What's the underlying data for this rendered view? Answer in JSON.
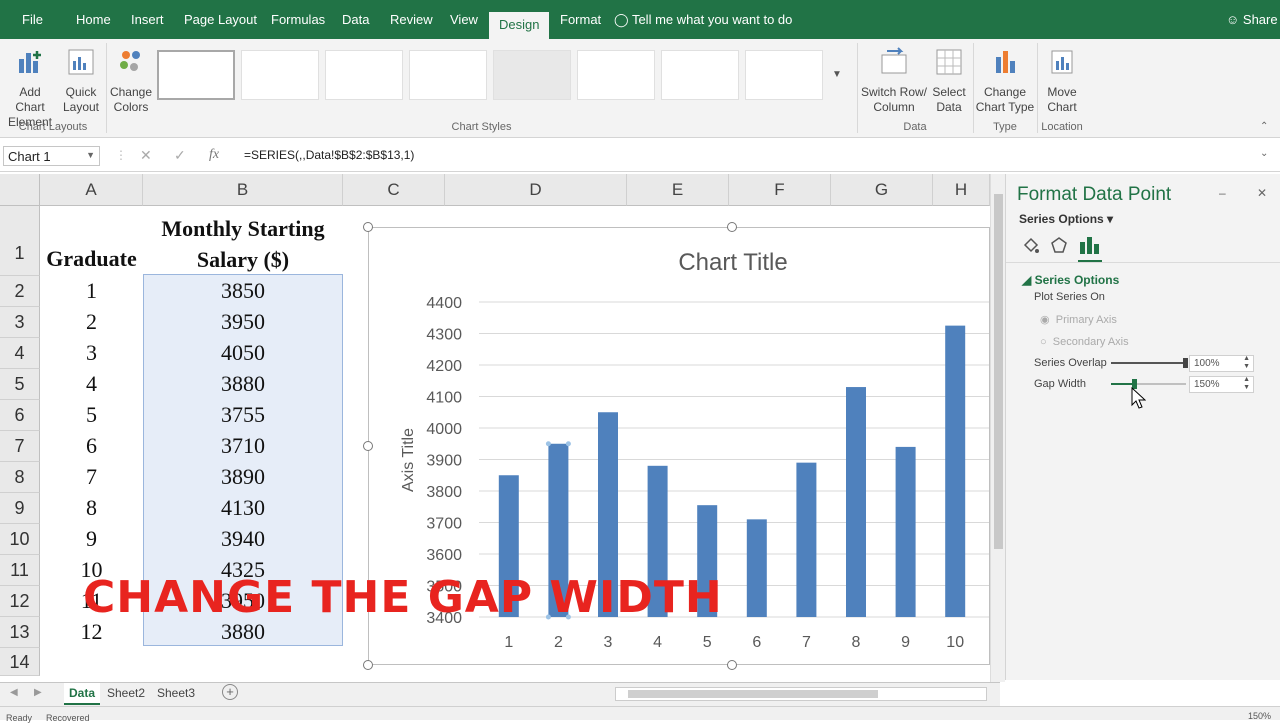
{
  "tabs": [
    "File",
    "Home",
    "Insert",
    "Page Layout",
    "Formulas",
    "Data",
    "Review",
    "View",
    "Design",
    "Format"
  ],
  "active_tab": "Design",
  "tell_me": "Tell me what you want to do",
  "share": "Share",
  "ribbon": {
    "add_chart_element": "Add Chart Element",
    "quick_layout": "Quick Layout",
    "change_colors": "Change Colors",
    "switch_row_column": "Switch Row/ Column",
    "select_data": "Select Data",
    "change_chart_type": "Change Chart Type",
    "move_chart": "Move Chart",
    "groups": [
      "Chart Layouts",
      "Chart Styles",
      "Data",
      "Type",
      "Location"
    ]
  },
  "formula_bar": {
    "name_box": "Chart 1",
    "fx": "fx",
    "formula": "=SERIES(,,Data!$B$2:$B$13,1)"
  },
  "columns": [
    "A",
    "B",
    "C",
    "D",
    "E",
    "F",
    "G",
    "H"
  ],
  "header_a": "Graduate",
  "header_b": "Monthly Starting Salary ($)",
  "rows": [
    {
      "r": "1"
    },
    {
      "r": "2",
      "a": "1",
      "b": "3850"
    },
    {
      "r": "3",
      "a": "2",
      "b": "3950"
    },
    {
      "r": "4",
      "a": "3",
      "b": "4050"
    },
    {
      "r": "5",
      "a": "4",
      "b": "3880"
    },
    {
      "r": "6",
      "a": "5",
      "b": "3755"
    },
    {
      "r": "7",
      "a": "6",
      "b": "3710"
    },
    {
      "r": "8",
      "a": "7",
      "b": "3890"
    },
    {
      "r": "9",
      "a": "8",
      "b": "4130"
    },
    {
      "r": "10",
      "a": "9",
      "b": "3940"
    },
    {
      "r": "11",
      "a": "10",
      "b": "4325"
    },
    {
      "r": "12",
      "a": "11",
      "b": "3950"
    },
    {
      "r": "13",
      "a": "12",
      "b": "3880"
    },
    {
      "r": "14"
    }
  ],
  "chart_data": {
    "type": "bar",
    "title": "Chart Title",
    "ylabel": "Axis Title",
    "xlabel": "",
    "categories": [
      "1",
      "2",
      "3",
      "4",
      "5",
      "6",
      "7",
      "8",
      "9",
      "10"
    ],
    "values": [
      3850,
      3950,
      4050,
      3880,
      3755,
      3710,
      3890,
      4130,
      3940,
      4325
    ],
    "ylim": [
      3400,
      4400
    ],
    "yticks": [
      3400,
      3500,
      3600,
      3700,
      3800,
      3900,
      4000,
      4100,
      4200,
      4300,
      4400
    ],
    "bar_color": "#4f81bd",
    "selected_index": 1
  },
  "panel": {
    "title": "Format Data Point",
    "series_options_dropdown": "Series Options",
    "section": "Series Options",
    "plot_series_on": "Plot Series On",
    "primary_axis": "Primary Axis",
    "secondary_axis": "Secondary Axis",
    "series_overlap_label": "Series Overlap",
    "series_overlap_value": "100%",
    "series_overlap_fraction": 1.0,
    "gap_width_label": "Gap Width",
    "gap_width_value": "150%",
    "gap_width_fraction": 0.3
  },
  "sheets": [
    "Data",
    "Sheet2",
    "Sheet3"
  ],
  "active_sheet": "Data",
  "status": {
    "ready": "Ready",
    "recovered": "Recovered",
    "zoom": "150%"
  },
  "overlay_text": "CHANGE THE GAP WIDTH",
  "colors": {
    "excel_green": "#217346",
    "overlay_red": "#e8241f",
    "accent_bar": "#4f81bd"
  }
}
